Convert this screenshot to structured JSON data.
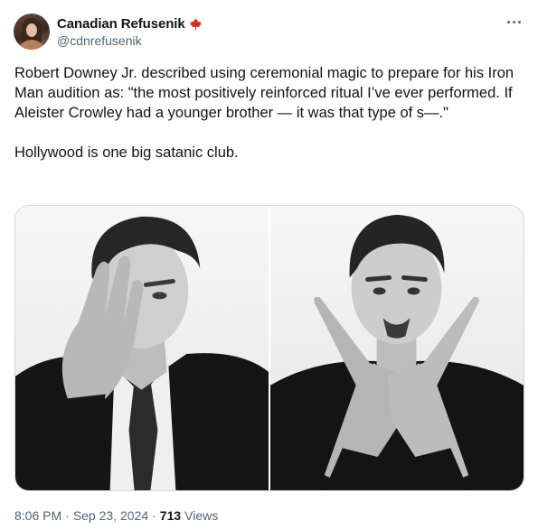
{
  "author": {
    "display_name": "Canadian Refusenik",
    "handle": "@cdnrefusenik",
    "flag_icon": "maple-leaf-icon",
    "flag_color": "#d52b1e"
  },
  "tweet": {
    "text": "Robert Downey Jr. described using ceremonial magic to prepare for his Iron Man audition as: \"the most positively reinforced ritual I’ve ever performed. If Aleister Crowley had a younger brother — it was that type of s—.\"\n\nHollywood is one big satanic club.",
    "time": "8:06 PM",
    "separator1": "·",
    "date": "Sep 23, 2024",
    "separator2": "·",
    "views_count": "713",
    "views_label": "Views"
  },
  "media": {
    "count": 2,
    "style": "black-and-white portraits"
  },
  "colors": {
    "text": "#0f1419",
    "secondary": "#536471",
    "border": "#cfd9de"
  }
}
